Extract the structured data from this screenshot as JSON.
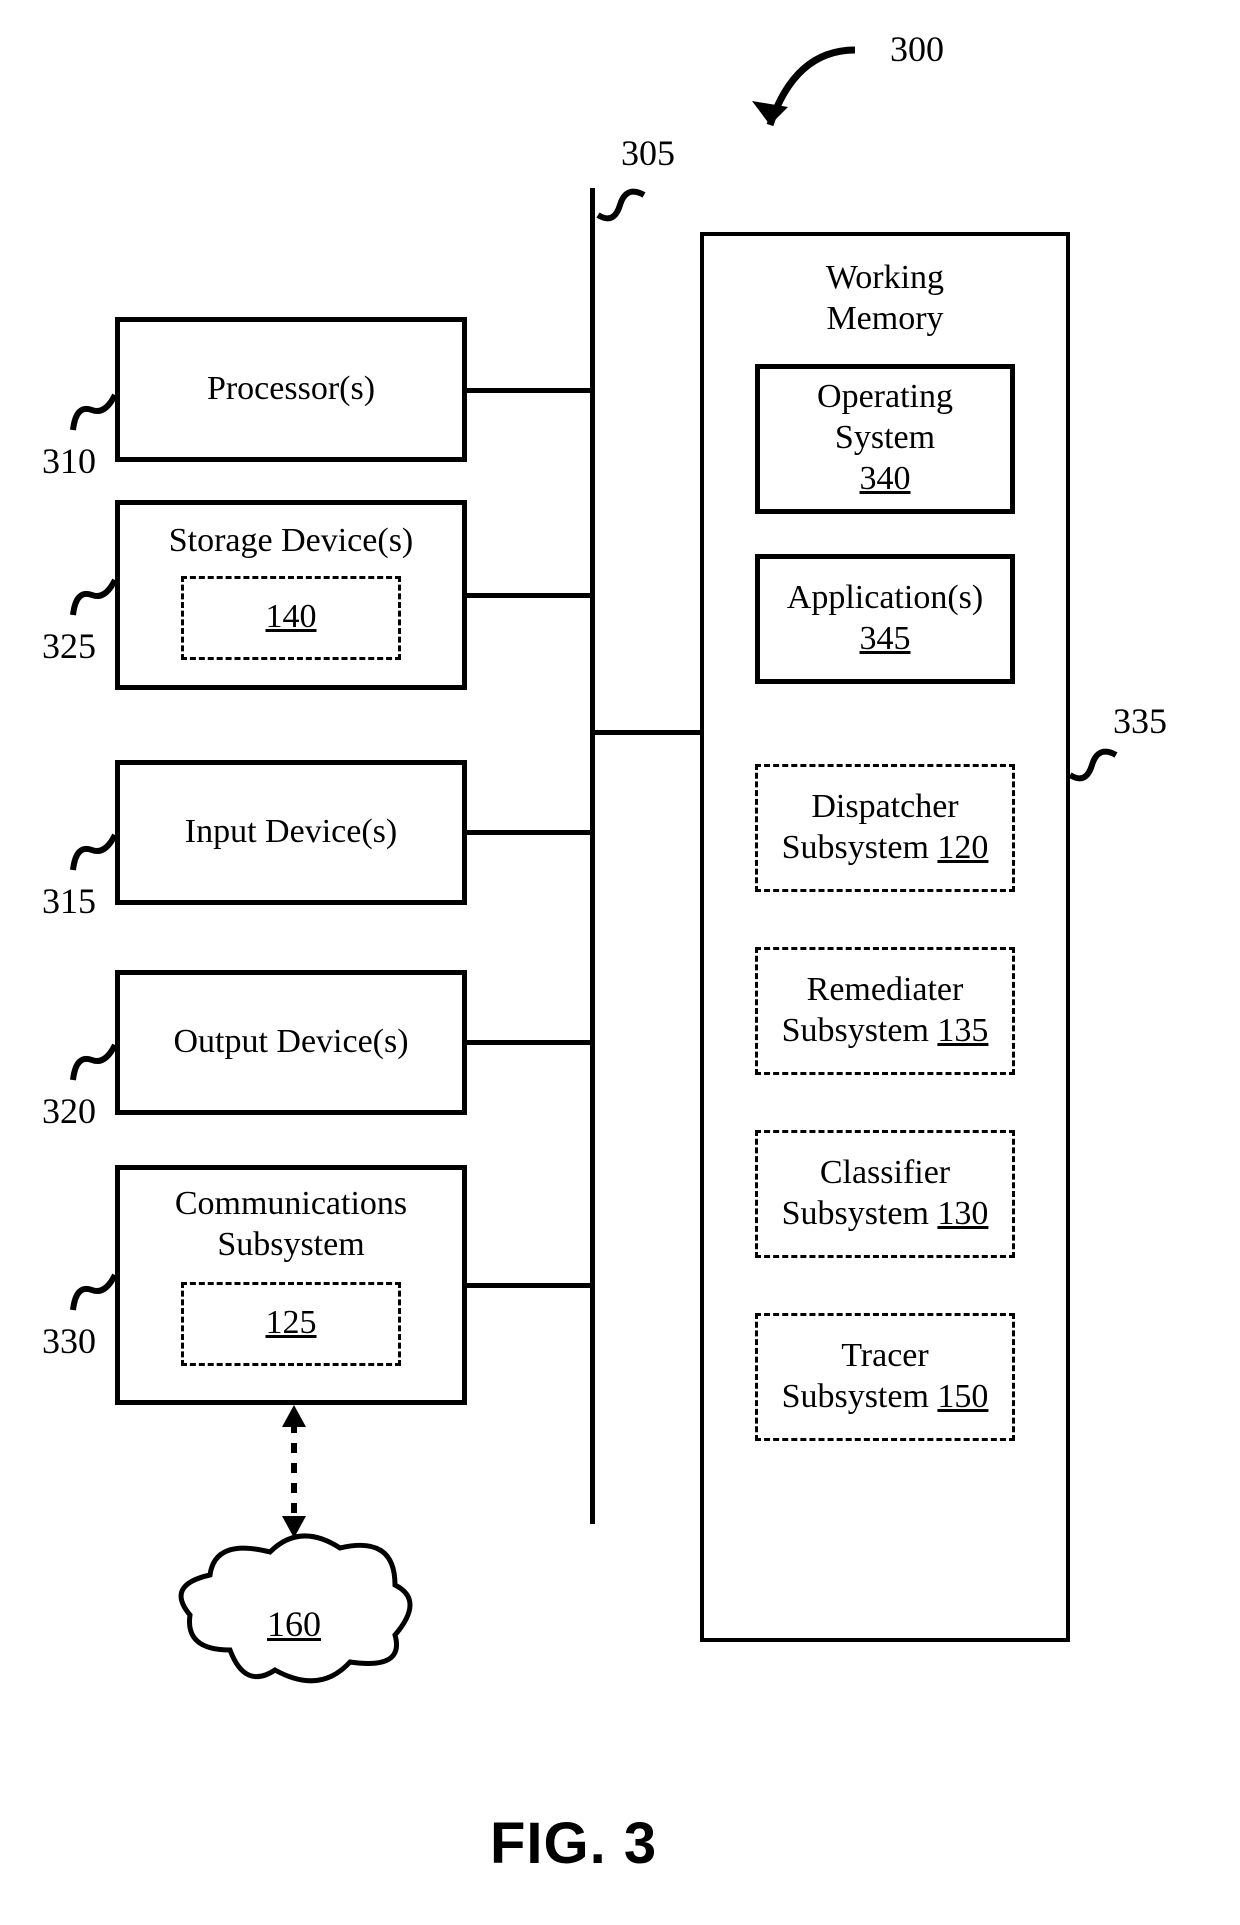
{
  "figure": {
    "title": "FIG. 3",
    "overall_ref": "300",
    "bus_ref": "305"
  },
  "left_blocks": {
    "processor": {
      "label": "Processor(s)",
      "ref": "310"
    },
    "storage": {
      "label": "Storage Device(s)",
      "ref": "325",
      "inner_ref": "140"
    },
    "input": {
      "label": "Input Device(s)",
      "ref": "315"
    },
    "output": {
      "label": "Output Device(s)",
      "ref": "320"
    },
    "comm": {
      "label": "Communications\nSubsystem",
      "ref": "330",
      "inner_ref": "125"
    }
  },
  "working_memory": {
    "label": "Working\nMemory",
    "ref": "335",
    "os": {
      "label": "Operating\nSystem",
      "ref": "340"
    },
    "apps": {
      "label": "Application(s)",
      "ref": "345"
    },
    "dispatcher": {
      "label": "Dispatcher\nSubsystem",
      "ref": "120"
    },
    "remediater": {
      "label": "Remediater\nSubsystem",
      "ref": "135"
    },
    "classifier": {
      "label": "Classifier\nSubsystem",
      "ref": "130"
    },
    "tracer": {
      "label": "Tracer\nSubsystem",
      "ref": "150"
    }
  },
  "cloud": {
    "ref": "160"
  }
}
